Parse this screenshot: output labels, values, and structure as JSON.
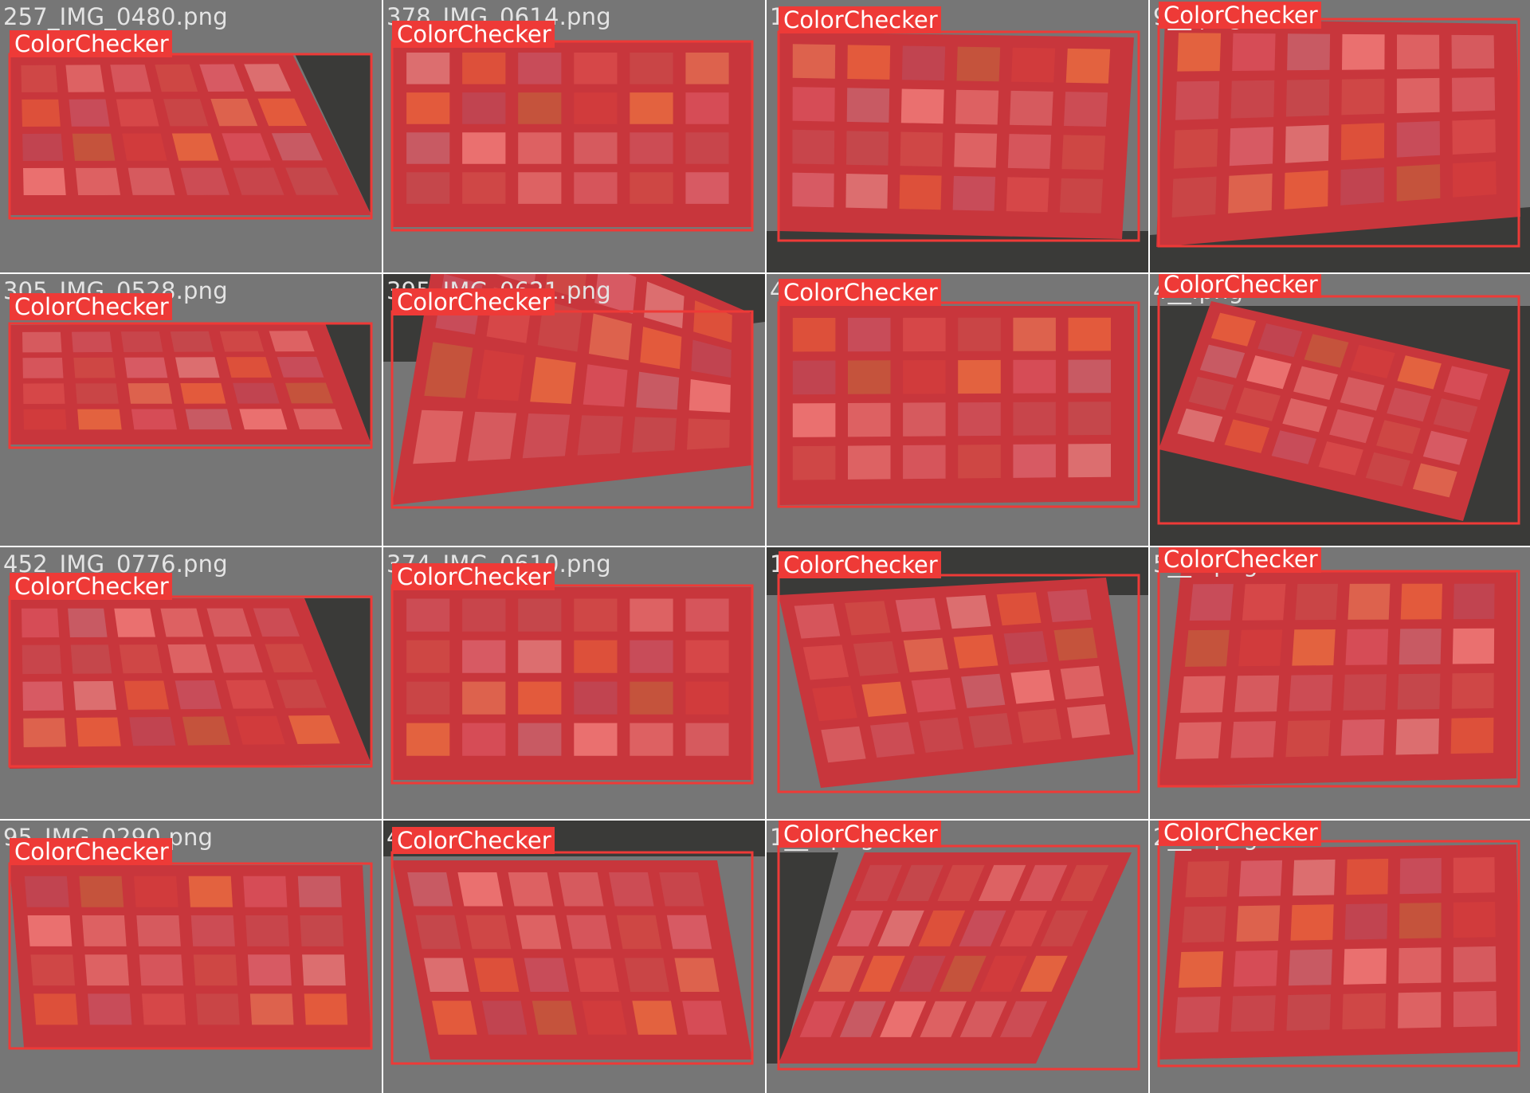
{
  "colors": {
    "background": "#767676",
    "box_outline": "#ee3a37",
    "label_bg": "#ee3a37",
    "label_text": "#ffffff",
    "filename_text": "#e4e4e4",
    "mask_fill": "#c8363c",
    "separator": "#ffffff"
  },
  "detections": [
    {
      "filename": "257_IMG_0480.png",
      "class_label": "ColorChecker"
    },
    {
      "filename": "378_IMG_0614.png",
      "class_label": "ColorChecker"
    },
    {
      "filename": "1__6.png",
      "class_label": "ColorChecker"
    },
    {
      "filename": "9__.png",
      "class_label": "ColorChecker"
    },
    {
      "filename": "305_IMG_0528.png",
      "class_label": "ColorChecker"
    },
    {
      "filename": "395_IMG_0621.png",
      "class_label": "ColorChecker"
    },
    {
      "filename": "4__1.png",
      "class_label": "ColorChecker"
    },
    {
      "filename": "4__.png",
      "class_label": "ColorChecker"
    },
    {
      "filename": "452_IMG_0776.png",
      "class_label": "ColorChecker"
    },
    {
      "filename": "374_IMG_0610.png",
      "class_label": "ColorChecker"
    },
    {
      "filename": "1__7.png",
      "class_label": "ColorChecker"
    },
    {
      "filename": "5__2.png",
      "class_label": "ColorChecker"
    },
    {
      "filename": "95_IMG_0290.png",
      "class_label": "ColorChecker"
    },
    {
      "filename": "4__7.png",
      "class_label": "ColorChecker"
    },
    {
      "filename": "1__7.png",
      "class_label": "ColorChecker"
    },
    {
      "filename": "2__7.png",
      "class_label": "ColorChecker"
    }
  ]
}
